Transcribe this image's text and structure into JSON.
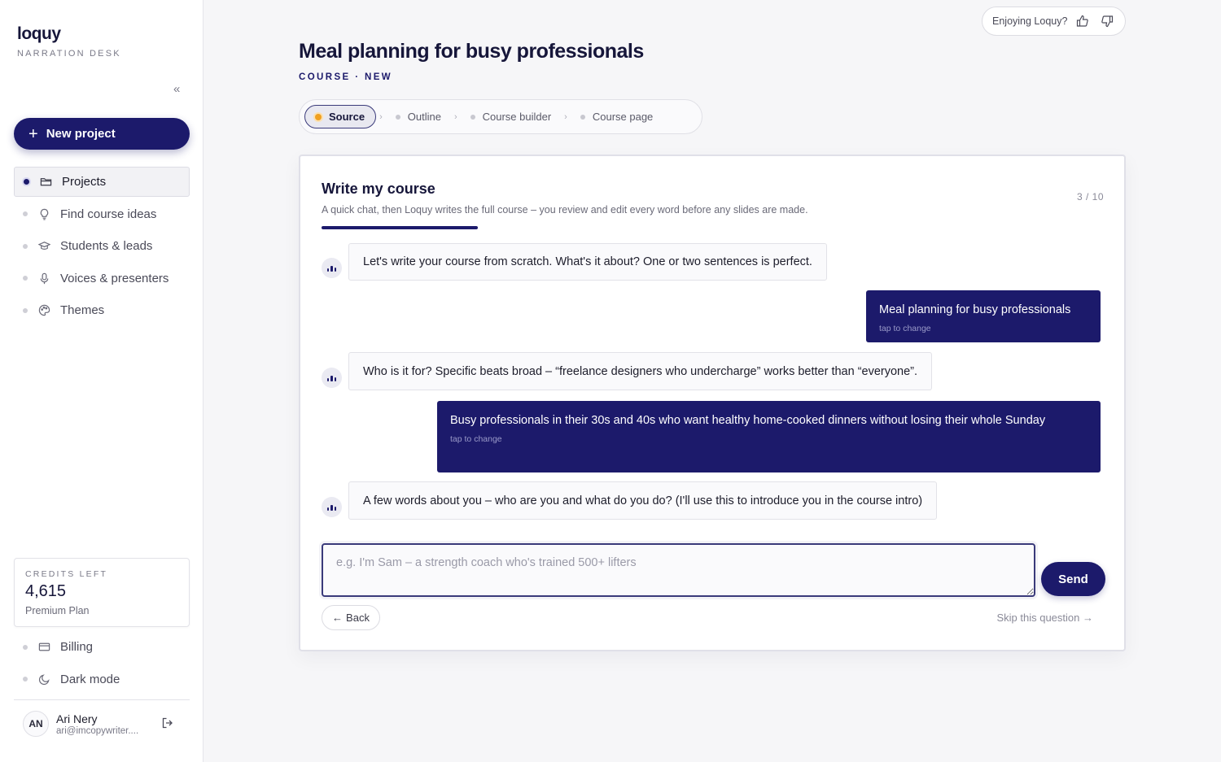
{
  "app": {
    "logo": "loquy",
    "subtitle": "NARRATION DESK",
    "collapse_icon": "«"
  },
  "sidebar": {
    "new_project_label": "New project",
    "items": [
      {
        "label": "Projects",
        "icon": "folder-icon",
        "active": true
      },
      {
        "label": "Find course ideas",
        "icon": "lightbulb-icon"
      },
      {
        "label": "Students & leads",
        "icon": "graduation-cap-icon"
      },
      {
        "label": "Voices & presenters",
        "icon": "microphone-icon"
      },
      {
        "label": "Themes",
        "icon": "palette-icon"
      }
    ],
    "credits": {
      "label": "CREDITS LEFT",
      "value": "4,615",
      "plan": "Premium Plan"
    },
    "bottom_items": [
      {
        "label": "Billing",
        "icon": "credit-card-icon"
      },
      {
        "label": "Dark mode",
        "icon": "moon-icon"
      }
    ],
    "user": {
      "initials": "AN",
      "name": "Ari Nery",
      "email": "ari@imcopywriter...."
    }
  },
  "feedback": {
    "label": "Enjoying Loquy?"
  },
  "header": {
    "title": "Meal planning for busy professionals",
    "subtitle": "COURSE · NEW"
  },
  "stepper": {
    "steps": [
      {
        "label": "Source",
        "active": true
      },
      {
        "label": "Outline"
      },
      {
        "label": "Course builder"
      },
      {
        "label": "Course page"
      }
    ]
  },
  "card": {
    "title": "Write my course",
    "description": "A quick chat, then Loquy writes the full course – you review and edit every word before any slides are made.",
    "counter": "3 / 10",
    "progress": 0.3,
    "messages": [
      {
        "from": "bot",
        "text": "Let's write your course from scratch. What's it about? One or two sentences is perfect."
      },
      {
        "from": "user",
        "text": "Meal planning for busy professionals",
        "hint": "tap to change"
      },
      {
        "from": "bot",
        "text": "Who is it for? Specific beats broad – “freelance designers who undercharge” works better than “everyone”."
      },
      {
        "from": "user",
        "text": "Busy professionals in their 30s and 40s who want healthy home-cooked dinners without losing their whole Sunday",
        "hint": "tap to change"
      },
      {
        "from": "bot",
        "text": "A few words about you – who are you and what do you do? (I'll use this to introduce you in the course intro)"
      }
    ],
    "input": {
      "placeholder": "e.g. I'm Sam – a strength coach who's trained 500+ lifters",
      "value": ""
    },
    "send_label": "Send",
    "back_label": "Back",
    "skip_label": "Skip this question →"
  },
  "colors": {
    "accent": "#1c1a6b",
    "active_step_dot": "#f0a020"
  }
}
